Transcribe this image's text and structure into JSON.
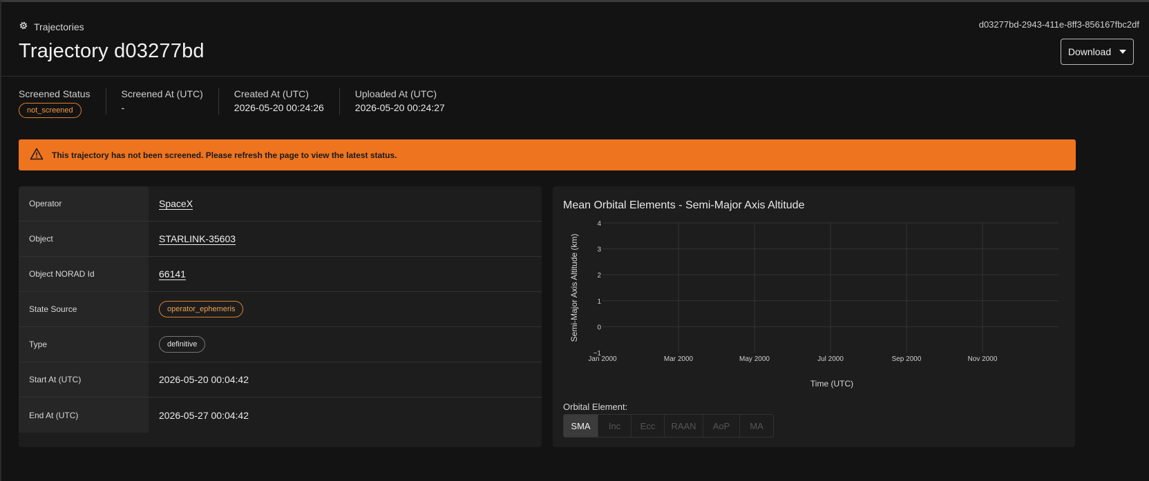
{
  "header": {
    "breadcrumb": "Trajectories",
    "breadcrumb_icon": "gear-icon",
    "title": "Trajectory d03277bd",
    "uuid": "d03277bd-2943-411e-8ff3-856167fbc2df",
    "download_label": "Download"
  },
  "stats": {
    "screened_status_label": "Screened Status",
    "screened_status_value": "not_screened",
    "screened_at_label": "Screened At (UTC)",
    "screened_at_value": "-",
    "created_at_label": "Created At (UTC)",
    "created_at_value": "2026-05-20 00:24:26",
    "uploaded_at_label": "Uploaded At (UTC)",
    "uploaded_at_value": "2026-05-20 00:24:27"
  },
  "alert": {
    "icon": "warning-icon",
    "message": "This trajectory has not been screened. Please refresh the page to view the latest status.",
    "color": "#ee7420"
  },
  "details": {
    "operator_label": "Operator",
    "operator_value": "SpaceX",
    "object_label": "Object",
    "object_value": "STARLINK-35603",
    "norad_label": "Object NORAD Id",
    "norad_value": "66141",
    "state_source_label": "State Source",
    "state_source_value": "operator_ephemeris",
    "type_label": "Type",
    "type_value": "definitive",
    "start_label": "Start At (UTC)",
    "start_value": "2026-05-20 00:04:42",
    "end_label": "End At (UTC)",
    "end_value": "2026-05-27 00:04:42"
  },
  "chart": {
    "title": "Mean Orbital Elements - Semi-Major Axis Altitude",
    "orbital_element_label": "Orbital Element:",
    "segments": [
      "SMA",
      "Inc",
      "Ecc",
      "RAAN",
      "AoP",
      "MA"
    ],
    "selected_segment": "SMA"
  },
  "chart_data": {
    "type": "line",
    "title": "Mean Orbital Elements - Semi-Major Axis Altitude",
    "xlabel": "Time (UTC)",
    "ylabel": "Semi-Major Axis Altitude (km)",
    "x_ticks": [
      "Jan 2000",
      "Mar 2000",
      "May 2000",
      "Jul 2000",
      "Sep 2000",
      "Nov 2000"
    ],
    "y_ticks": [
      "4",
      "3",
      "2",
      "1",
      "0",
      "−1"
    ],
    "ylim": [
      -1,
      4
    ],
    "series": [],
    "grid": true
  }
}
